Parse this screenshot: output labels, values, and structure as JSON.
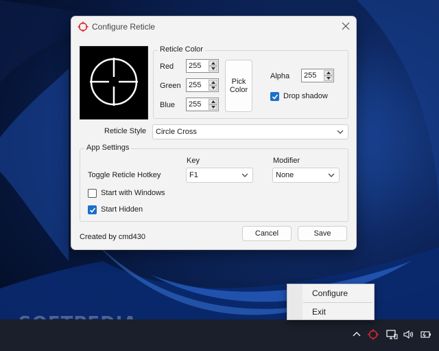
{
  "dialog": {
    "title": "Configure Reticle",
    "reticle_color": {
      "group_title": "Reticle Color",
      "red_label": "Red",
      "red_value": "255",
      "green_label": "Green",
      "green_value": "255",
      "blue_label": "Blue",
      "blue_value": "255",
      "pick_color_line1": "Pick",
      "pick_color_line2": "Color",
      "alpha_label": "Alpha",
      "alpha_value": "255",
      "drop_shadow_label": "Drop shadow",
      "drop_shadow_checked": true
    },
    "reticle_style": {
      "label": "Reticle Style",
      "value": "Circle Cross"
    },
    "app_settings": {
      "group_title": "App Settings",
      "key_header": "Key",
      "modifier_header": "Modifier",
      "hotkey_label": "Toggle Reticle Hotkey",
      "key_value": "F1",
      "modifier_value": "None",
      "start_windows_label": "Start with Windows",
      "start_windows_checked": false,
      "start_hidden_label": "Start Hidden",
      "start_hidden_checked": true
    },
    "footer": {
      "credit": "Created by cmd430",
      "cancel_label": "Cancel",
      "save_label": "Save"
    }
  },
  "context_menu": {
    "configure_label": "Configure",
    "exit_label": "Exit"
  },
  "watermark": "SOFTPEDIA",
  "colors": {
    "accent": "#1a6fc9",
    "reticle_icon": "#e0262a",
    "dialog_bg": "#f3f3f3",
    "taskbar": "#1a1f2b"
  }
}
